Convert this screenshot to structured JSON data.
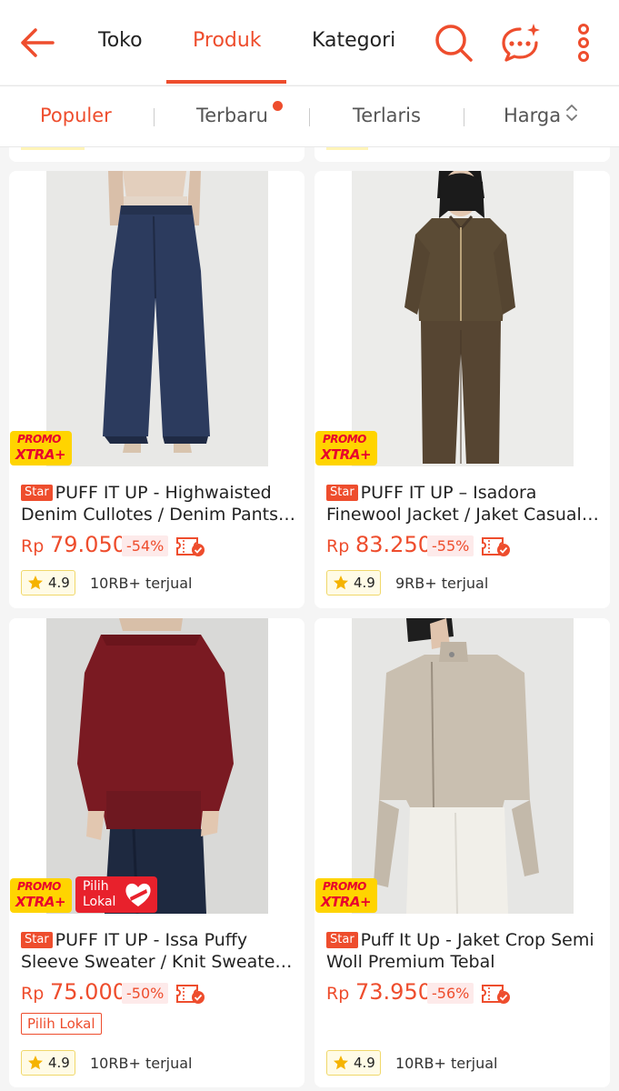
{
  "header": {
    "tabs": [
      {
        "label": "Toko",
        "active": false
      },
      {
        "label": "Produk",
        "active": true
      },
      {
        "label": "Kategori",
        "active": false
      }
    ],
    "icons": [
      "back-arrow-icon",
      "search-icon",
      "chat-icon",
      "more-vertical-icon"
    ]
  },
  "sort": {
    "items": [
      {
        "label": "Populer",
        "active": true
      },
      {
        "label": "Terbaru",
        "active": false,
        "new_dot": true
      },
      {
        "label": "Terlaris",
        "active": false
      },
      {
        "label": "Harga",
        "active": false,
        "sort_icon": "up-down-arrows-icon"
      }
    ]
  },
  "products": [
    {
      "badge": "Star",
      "title": "PUFF IT UP - Highwaisted Denim Cullotes / Denim Pants / ...",
      "title_lines": [
        "PUFF IT UP - Highwaisted",
        "Denim Cullotes / Denim Pants /..."
      ],
      "currency": "Rp",
      "price": "79.050",
      "discount": "-54%",
      "promo": {
        "line1": "PROMO",
        "line2": "XTRA+"
      },
      "pilih_lokal": false,
      "rating": "4.9",
      "sold": "10RB+ terjual"
    },
    {
      "badge": "Star",
      "title": "PUFF IT UP – Isadora Finewool Jacket / Jaket Casual ...",
      "title_lines": [
        "PUFF IT UP – Isadora",
        "Finewool Jacket / Jaket Casual ..."
      ],
      "currency": "Rp",
      "price": "83.250",
      "discount": "-55%",
      "promo": {
        "line1": "PROMO",
        "line2": "XTRA+"
      },
      "pilih_lokal": false,
      "rating": "4.9",
      "sold": "9RB+ terjual"
    },
    {
      "badge": "Star",
      "title": "PUFF IT UP - Issa Puffy Sleeve Sweater / Knit Sweater /...",
      "title_lines": [
        "PUFF IT UP - Issa Puffy",
        "Sleeve Sweater / Knit Sweater /..."
      ],
      "currency": "Rp",
      "price": "75.000",
      "discount": "-50%",
      "promo": {
        "line1": "PROMO",
        "line2": "XTRA+"
      },
      "pilih_lokal": true,
      "lokal_badge": {
        "line1": "Pilih",
        "line2": "Lokal"
      },
      "lokal_tag": "Pilih Lokal",
      "rating": "4.9",
      "sold": "10RB+ terjual"
    },
    {
      "badge": "Star",
      "title": "Puff It Up - Jaket Crop Semi Woll Premium Tebal",
      "title_lines": [
        "Puff It Up - Jaket Crop Semi",
        "Woll Premium Tebal"
      ],
      "currency": "Rp",
      "price": "73.950",
      "discount": "-56%",
      "promo": {
        "line1": "PROMO",
        "line2": "XTRA+"
      },
      "pilih_lokal": false,
      "rating": "4.9",
      "sold": "10RB+ terjual"
    }
  ],
  "colors": {
    "accent": "#ee4d2d",
    "promo_yellow": "#ffd400",
    "lokal_red": "#e8212c"
  }
}
